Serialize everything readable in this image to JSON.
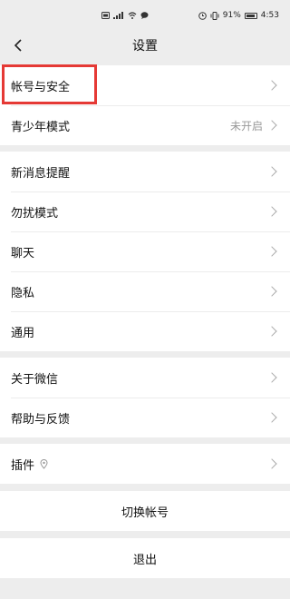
{
  "status_bar": {
    "left_icons": [
      "sim-icon",
      "signal-icon",
      "wifi-icon",
      "message-icon"
    ],
    "battery_percent": "91%",
    "time": "4:53"
  },
  "nav": {
    "title": "设置",
    "back_icon": "chevron-left-icon"
  },
  "groups": [
    {
      "items": [
        {
          "label": "帐号与安全",
          "value": ""
        },
        {
          "label": "青少年模式",
          "value": "未开启"
        }
      ]
    },
    {
      "items": [
        {
          "label": "新消息提醒",
          "value": ""
        },
        {
          "label": "勿扰模式",
          "value": ""
        },
        {
          "label": "聊天",
          "value": ""
        },
        {
          "label": "隐私",
          "value": ""
        },
        {
          "label": "通用",
          "value": ""
        }
      ]
    },
    {
      "items": [
        {
          "label": "关于微信",
          "value": ""
        },
        {
          "label": "帮助与反馈",
          "value": ""
        }
      ]
    },
    {
      "items": [
        {
          "label": "插件",
          "value": "",
          "icon": "location-pin-icon"
        }
      ]
    }
  ],
  "actions": {
    "switch_account": "切换帐号",
    "logout": "退出"
  },
  "colors": {
    "background": "#ededed",
    "highlight": "#e53935"
  }
}
